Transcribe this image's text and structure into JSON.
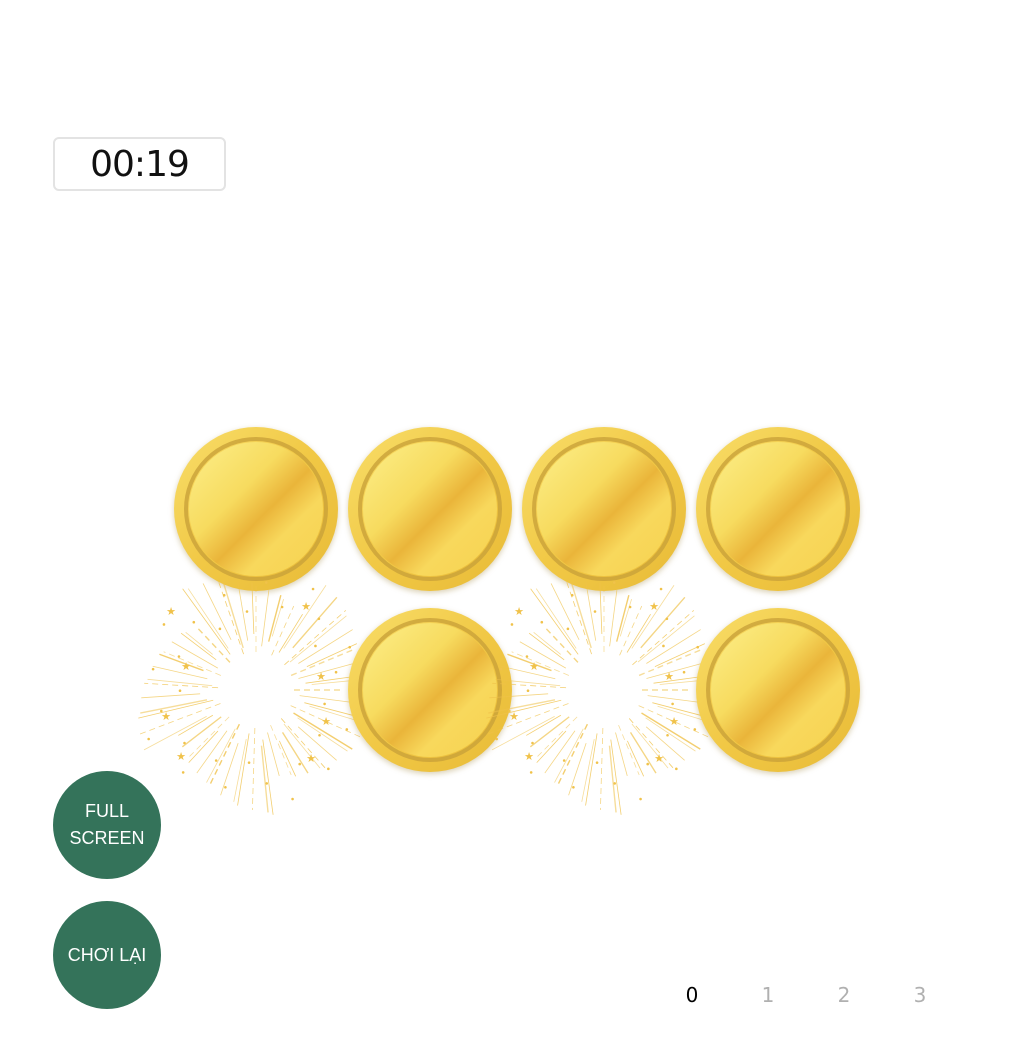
{
  "timer": {
    "value": "00:19"
  },
  "board": {
    "cards": [
      {
        "name": "coin-card-1",
        "state": "closed"
      },
      {
        "name": "coin-card-2",
        "state": "closed"
      },
      {
        "name": "coin-card-3",
        "state": "closed"
      },
      {
        "name": "coin-card-4",
        "state": "closed"
      },
      {
        "name": "coin-card-5",
        "state": "revealed-burst"
      },
      {
        "name": "coin-card-6",
        "state": "closed"
      },
      {
        "name": "coin-card-7",
        "state": "revealed-burst"
      },
      {
        "name": "coin-card-8",
        "state": "closed"
      }
    ]
  },
  "buttons": {
    "fullscreen_label": "FULL\nSCREEN",
    "replay_label": "CHƠI LẠI"
  },
  "pagination": {
    "pages": [
      "0",
      "1",
      "2",
      "3"
    ],
    "active_index": 0
  },
  "colors": {
    "button_bg": "#34735a",
    "coin_gold": "#f4cf4e",
    "burst_gold": "#f0c24a"
  }
}
